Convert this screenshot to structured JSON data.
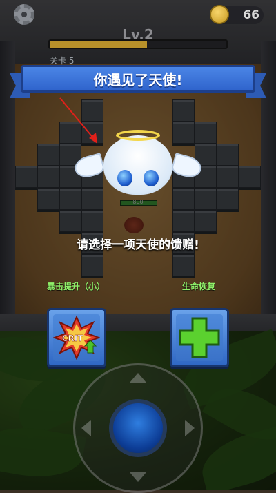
{
  "hud": {
    "coins": "66",
    "level_label": "Lv.2",
    "xp_progress": 0.55,
    "stage_label": "关卡 5"
  },
  "dialog": {
    "banner_title": "你遇见了天使!",
    "prompt": "请选择一项天使的馈赠!",
    "options": [
      {
        "label": "暴击提升（小）",
        "icon": "crit-up-icon",
        "icon_text": "CRIT"
      },
      {
        "label": "生命恢复",
        "icon": "green-plus-icon"
      }
    ]
  },
  "enemy": {
    "hp_text": "800"
  },
  "colors": {
    "banner_blue": "#3a72d8",
    "option_label_green": "#8ff06a",
    "crit_red": "#e23a2a",
    "heal_green": "#5bd12f",
    "coin_gold": "#e3b43b"
  }
}
